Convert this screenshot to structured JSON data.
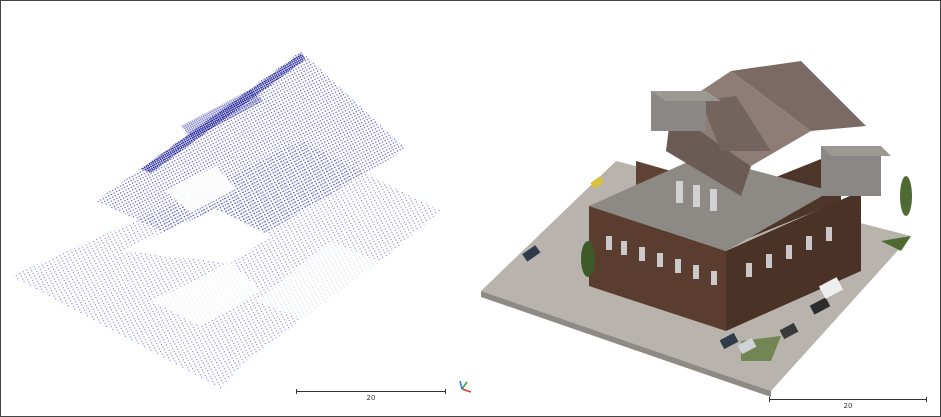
{
  "scale_bars": {
    "left_label": "20",
    "right_label": "20"
  },
  "colors": {
    "point_cloud": "#3b3fc8",
    "point_cloud_dense": "#1c1c9a",
    "roof_stone": "#8d7d76",
    "roof_shadow": "#6a5b57",
    "wall_brick": "#5a3d2e",
    "window_light": "#d9d9dc",
    "ground": "#b8b3ad",
    "vegetation": "#4f6b33",
    "axis_x": "#e53935",
    "axis_y": "#43a047",
    "axis_z": "#1e88e5"
  },
  "icons": {
    "orientation_gizmo": "xyz-axes-icon"
  }
}
